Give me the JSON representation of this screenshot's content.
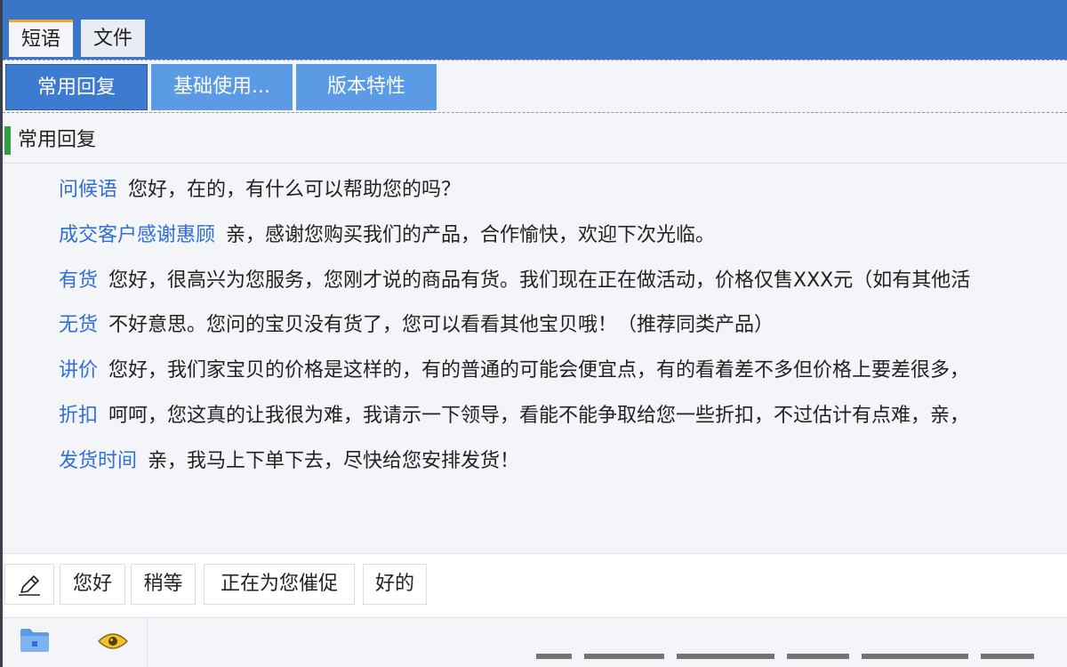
{
  "top_tabs": [
    {
      "label": "短语",
      "active": true
    },
    {
      "label": "文件",
      "active": false
    }
  ],
  "category_tabs": [
    {
      "label": "常用回复",
      "active": true
    },
    {
      "label": "基础使用...",
      "active": false
    },
    {
      "label": "版本特性",
      "active": false
    }
  ],
  "section": {
    "title": "常用回复"
  },
  "phrases": [
    {
      "key": "问候语",
      "text": "您好，在的，有什么可以帮助您的吗？"
    },
    {
      "key": "成交客户感谢惠顾",
      "text": "亲，感谢您购买我们的产品，合作愉快，欢迎下次光临。"
    },
    {
      "key": "有货",
      "text": "您好，很高兴为您服务，您刚才说的商品有货。我们现在正在做活动，价格仅售XXX元（如有其他活"
    },
    {
      "key": "无货",
      "text": "不好意思。您问的宝贝没有货了，您可以看看其他宝贝哦！（推荐同类产品）"
    },
    {
      "key": "讲价",
      "text": "您好，我们家宝贝的价格是这样的，有的普通的可能会便宜点，有的看着差不多但价格上要差很多，"
    },
    {
      "key": "折扣",
      "text": "呵呵，您这真的让我很为难，我请示一下领导，看能不能争取给您一些折扣，不过估计有点难，亲，"
    },
    {
      "key": "发货时间",
      "text": "亲，我马上下单下去，尽快给您安排发货！"
    }
  ],
  "quick_replies": [
    "您好",
    "稍等",
    "正在为您催促",
    "好的"
  ],
  "icons": {
    "edit": "pencil-icon",
    "folder": "folder-icon",
    "eye": "eye-icon"
  },
  "colors": {
    "header_blue": "#3a76c8",
    "tab_blue": "#5b9be6",
    "tab_active_blue": "#3d7bd0",
    "key_blue": "#2f6fd6",
    "section_green": "#2ea043",
    "active_tab_accent": "#f2a531"
  }
}
